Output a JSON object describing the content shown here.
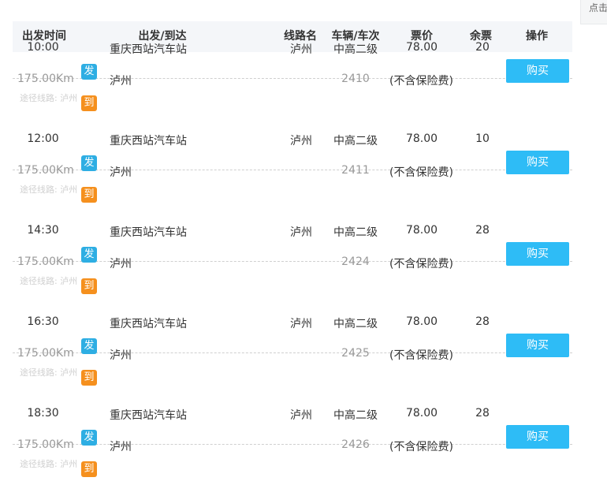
{
  "side_tab": {
    "label": "点击"
  },
  "header": {
    "time": "出发时间",
    "route": "出发/到达",
    "line": "线路名",
    "vehicle": "车辆/车次",
    "price": "票价",
    "seats": "余票",
    "operation": "操作"
  },
  "trips": [
    {
      "time": "10:00",
      "distance": "175.00Km",
      "via": "途径线路: 泸州",
      "dep_badge": "发",
      "arr_badge": "到",
      "departure": "重庆西站汽车站",
      "arrival": "泸州",
      "line": "泸州",
      "vehicle": "中高二级",
      "trip_no": "2410",
      "price": "78.00",
      "price_note": "(不含保险费)",
      "seats": "20",
      "buy": "购买"
    },
    {
      "time": "12:00",
      "distance": "175.00Km",
      "via": "途径线路: 泸州",
      "dep_badge": "发",
      "arr_badge": "到",
      "departure": "重庆西站汽车站",
      "arrival": "泸州",
      "line": "泸州",
      "vehicle": "中高二级",
      "trip_no": "2411",
      "price": "78.00",
      "price_note": "(不含保险费)",
      "seats": "10",
      "buy": "购买"
    },
    {
      "time": "14:30",
      "distance": "175.00Km",
      "via": "途径线路: 泸州",
      "dep_badge": "发",
      "arr_badge": "到",
      "departure": "重庆西站汽车站",
      "arrival": "泸州",
      "line": "泸州",
      "vehicle": "中高二级",
      "trip_no": "2424",
      "price": "78.00",
      "price_note": "(不含保险费)",
      "seats": "28",
      "buy": "购买"
    },
    {
      "time": "16:30",
      "distance": "175.00Km",
      "via": "途径线路: 泸州",
      "dep_badge": "发",
      "arr_badge": "到",
      "departure": "重庆西站汽车站",
      "arrival": "泸州",
      "line": "泸州",
      "vehicle": "中高二级",
      "trip_no": "2425",
      "price": "78.00",
      "price_note": "(不含保险费)",
      "seats": "28",
      "buy": "购买"
    },
    {
      "time": "18:30",
      "distance": "175.00Km",
      "via": "途径线路: 泸州",
      "dep_badge": "发",
      "arr_badge": "到",
      "departure": "重庆西站汽车站",
      "arrival": "泸州",
      "line": "泸州",
      "vehicle": "中高二级",
      "trip_no": "2426",
      "price": "78.00",
      "price_note": "(不含保险费)",
      "seats": "28",
      "buy": "购买"
    }
  ],
  "colors": {
    "departure_badge": "#2eaee3",
    "arrival_badge": "#f5901e",
    "buy_button": "#2ebcf6",
    "header_bg": "#f4f6f9"
  }
}
